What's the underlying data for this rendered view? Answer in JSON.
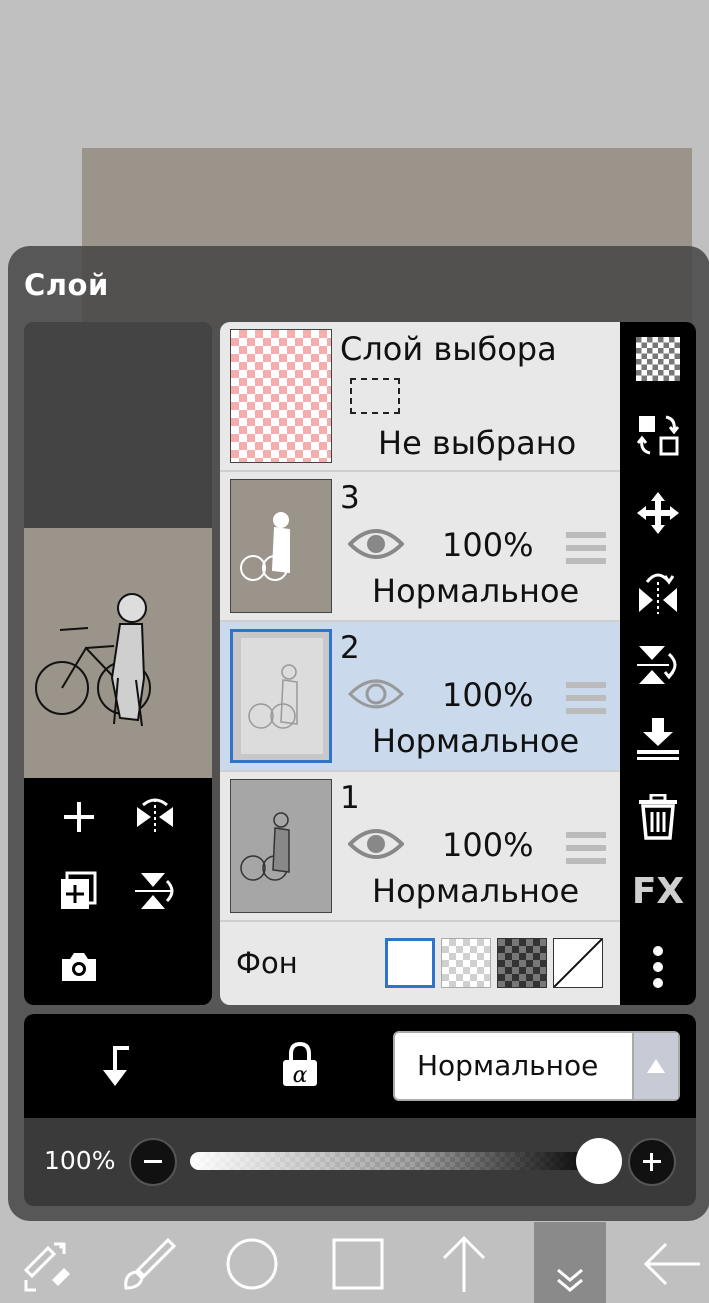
{
  "panel": {
    "title": "Слой"
  },
  "selection_layer": {
    "title": "Слой выбора",
    "state": "Не выбрано"
  },
  "layers": [
    {
      "number": "3",
      "opacity": "100%",
      "blend": "Нормальное",
      "selected": false
    },
    {
      "number": "2",
      "opacity": "100%",
      "blend": "Нормальное",
      "selected": true
    },
    {
      "number": "1",
      "opacity": "100%",
      "blend": "Нормальное",
      "selected": false
    }
  ],
  "background_row": {
    "label": "Фон",
    "options": [
      "white",
      "transparent",
      "dark-checker",
      "none"
    ],
    "selected": "white"
  },
  "blend_bar": {
    "selected_mode": "Нормальное"
  },
  "opacity_slider": {
    "label": "100%",
    "value_percent": 100
  },
  "right_tools": [
    "transparency-icon",
    "swap-layers-icon",
    "move-icon",
    "flip-horizontal-icon",
    "flip-vertical-icon",
    "merge-down-icon",
    "delete-icon",
    "fx-icon",
    "more-icon"
  ],
  "right_tools_fx_label": "FX",
  "bottom_tools": [
    "transform-icon",
    "brush-icon",
    "ellipse-icon",
    "rectangle-icon",
    "arrow-up-icon",
    "collapse-icon",
    "back-icon"
  ],
  "colors": {
    "accent": "#2f74c8",
    "selected_row": "#cbd9ec",
    "panel": "#484848"
  }
}
